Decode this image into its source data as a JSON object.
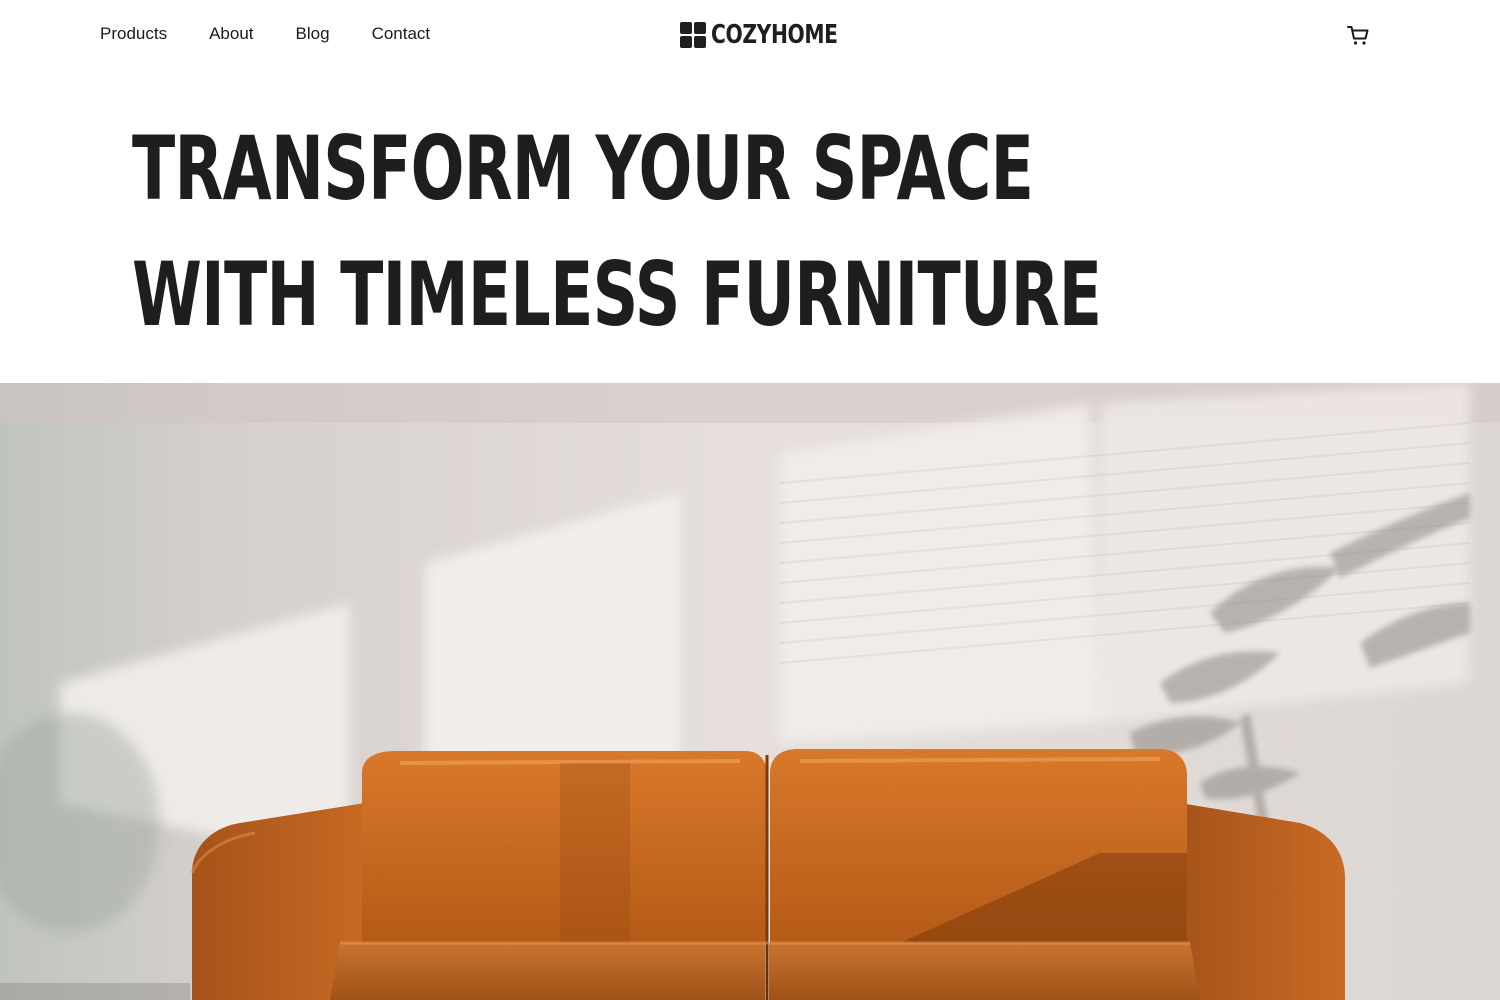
{
  "nav": {
    "items": [
      {
        "label": "Products"
      },
      {
        "label": "About"
      },
      {
        "label": "Blog"
      },
      {
        "label": "Contact"
      }
    ]
  },
  "brand": {
    "name": "COZYHOME",
    "logo_icon": "four-squares-logo-icon"
  },
  "header": {
    "cart_icon": "shopping-cart-icon"
  },
  "hero": {
    "title_line1": "TRANSFORM YOUR SPACE",
    "title_line2": "WITH TIMELESS FURNITURE",
    "image_subject": "orange-leather-sofa-photo"
  },
  "colors": {
    "text": "#1e1e1e",
    "background": "#ffffff",
    "sofa": "#c8681f",
    "wall": "#e6dedb"
  }
}
